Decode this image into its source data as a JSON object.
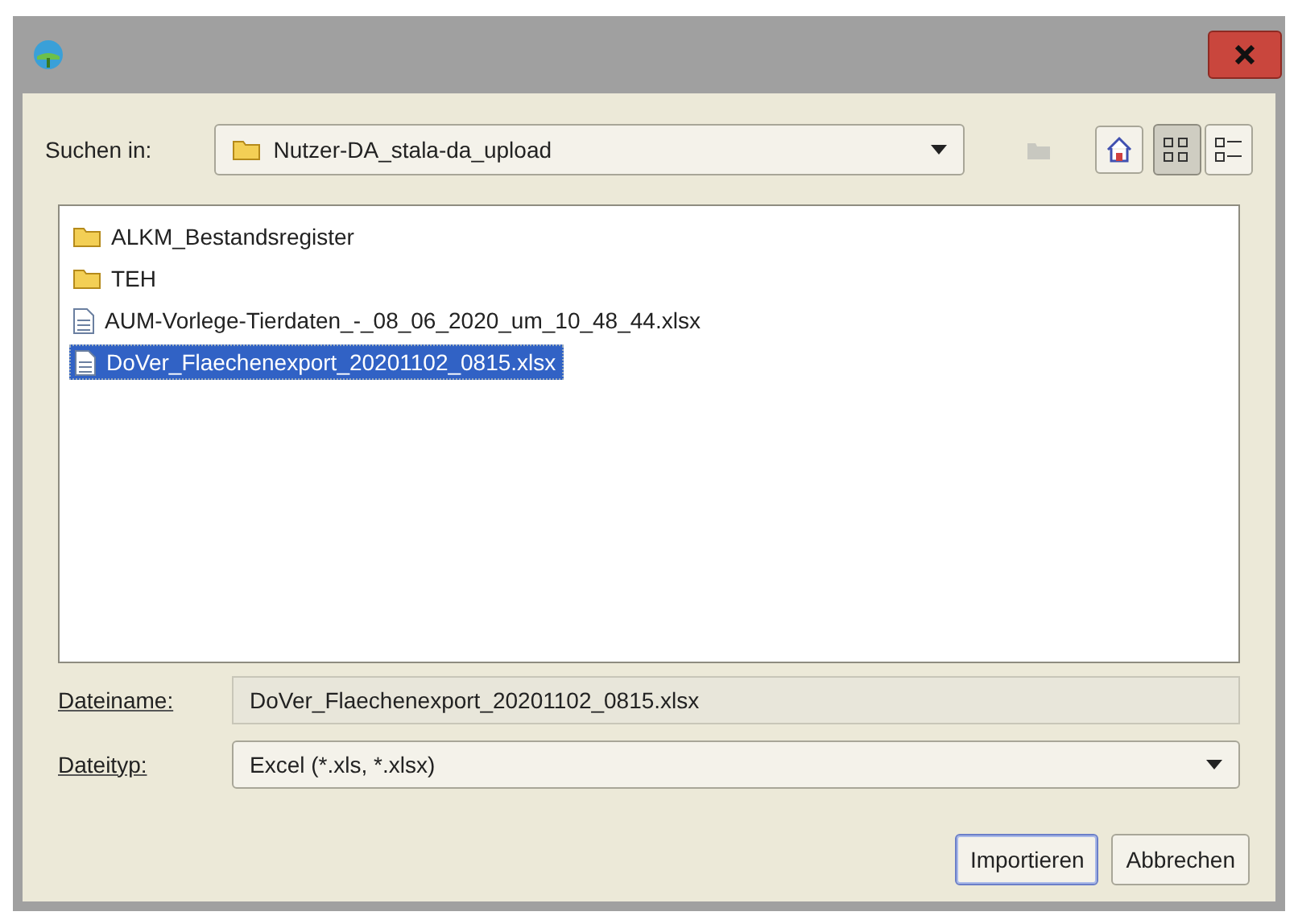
{
  "look_in": {
    "label": "Suchen in:",
    "value": "Nutzer-DA_stala-da_upload"
  },
  "view_modes": [
    {
      "kind": "list",
      "selected": true
    },
    {
      "kind": "details",
      "selected": false
    }
  ],
  "files": [
    {
      "kind": "folder",
      "name": "ALKM_Bestandsregister",
      "selected": false
    },
    {
      "kind": "folder",
      "name": "TEH",
      "selected": false
    },
    {
      "kind": "file",
      "name": "AUM-Vorlege-Tierdaten_-_08_06_2020_um_10_48_44.xlsx",
      "selected": false
    },
    {
      "kind": "file",
      "name": "DoVer_Flaechenexport_20201102_0815.xlsx",
      "selected": true
    }
  ],
  "file_name": {
    "label": "Dateiname:",
    "value": "DoVer_Flaechenexport_20201102_0815.xlsx"
  },
  "file_type": {
    "label": "Dateityp:",
    "value": "Excel (*.xls, *.xlsx)"
  },
  "buttons": [
    "Importieren",
    "Abbrechen"
  ]
}
